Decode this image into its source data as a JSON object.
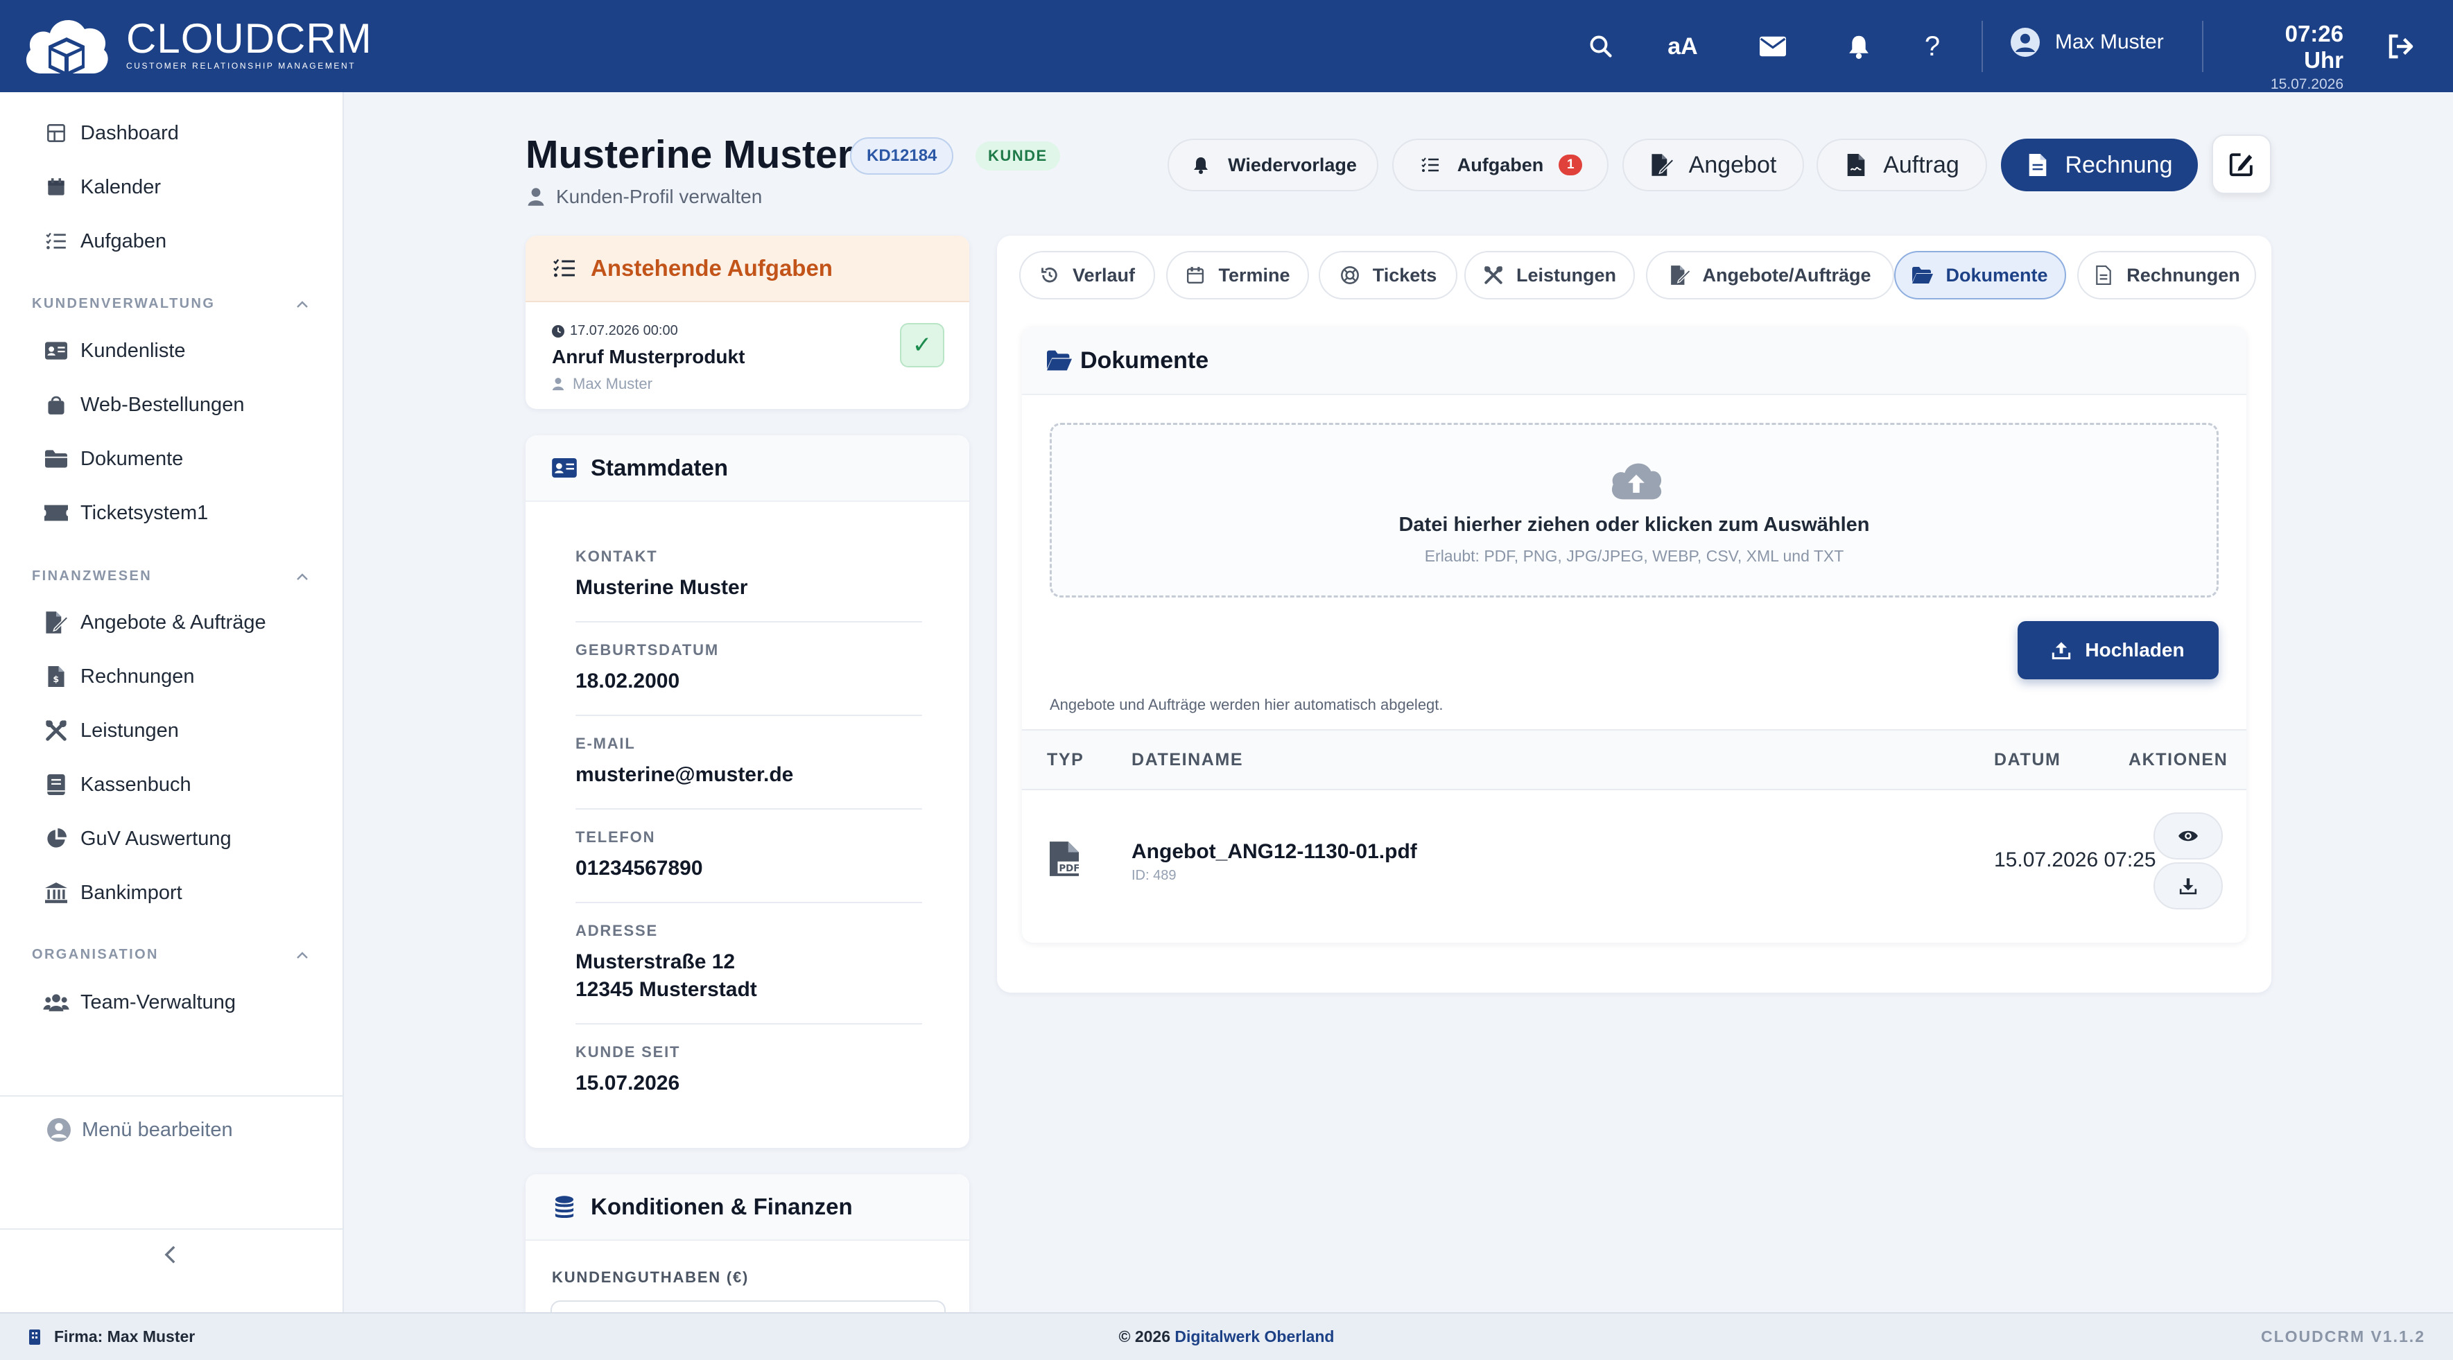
{
  "topbar": {
    "logo_name": "CLOUDCRM",
    "logo_sub": "CUSTOMER RELATIONSHIP MANAGEMENT",
    "font_size_label": "aA",
    "user_name": "Max Muster",
    "time": "07:26 Uhr",
    "date": "15.07.2026"
  },
  "sidebar": {
    "items_top": [
      {
        "label": "Dashboard",
        "icon": "dashboard-icon"
      },
      {
        "label": "Kalender",
        "icon": "calendar-icon"
      },
      {
        "label": "Aufgaben",
        "icon": "tasks-icon"
      }
    ],
    "sections": [
      {
        "title": "KUNDENVERWALTUNG",
        "items": [
          {
            "label": "Kundenliste",
            "icon": "id-card-icon"
          },
          {
            "label": "Web-Bestellungen",
            "icon": "shopping-bag-icon"
          },
          {
            "label": "Dokumente",
            "icon": "folder-icon"
          },
          {
            "label": "Ticketsystem1",
            "icon": "ticket-icon"
          }
        ]
      },
      {
        "title": "FINANZWESEN",
        "items": [
          {
            "label": "Angebote & Aufträge",
            "icon": "file-signature-icon"
          },
          {
            "label": "Rechnungen",
            "icon": "invoice-icon"
          },
          {
            "label": "Leistungen",
            "icon": "tools-icon"
          },
          {
            "label": "Kassenbuch",
            "icon": "book-icon"
          },
          {
            "label": "GuV Auswertung",
            "icon": "pie-chart-icon"
          },
          {
            "label": "Bankimport",
            "icon": "bank-icon"
          }
        ]
      },
      {
        "title": "ORGANISATION",
        "items": [
          {
            "label": "Team-Verwaltung",
            "icon": "users-icon"
          }
        ]
      }
    ],
    "menu_edit": "Menü bearbeiten"
  },
  "header": {
    "customer_name": "Musterine Muster",
    "customer_id": "KD12184",
    "customer_status": "KUNDE",
    "subtitle": "Kunden-Profil verwalten",
    "buttons": {
      "wiedervorlage": "Wiedervorlage",
      "aufgaben": "Aufgaben",
      "aufgaben_count": "1",
      "angebot": "Angebot",
      "auftrag": "Auftrag",
      "rechnung": "Rechnung"
    }
  },
  "tasks_card": {
    "title": "Anstehende Aufgaben",
    "task": {
      "date": "17.07.2026 00:00",
      "title": "Anruf Musterprodukt",
      "owner": "Max Muster",
      "done_symbol": "✓"
    }
  },
  "stammdaten": {
    "title": "Stammdaten",
    "fields": [
      {
        "label": "KONTAKT",
        "value": "Musterine Muster"
      },
      {
        "label": "GEBURTSDATUM",
        "value": "18.02.2000"
      },
      {
        "label": "E-MAIL",
        "value": "musterine@muster.de"
      },
      {
        "label": "TELEFON",
        "value": "01234567890"
      },
      {
        "label": "ADRESSE",
        "value": "Musterstraße 12",
        "value2": "12345 Musterstadt"
      },
      {
        "label": "KUNDE SEIT",
        "value": "15.07.2026"
      }
    ]
  },
  "konditionen": {
    "title": "Konditionen & Finanzen",
    "field_label": "KUNDENGUTHABEN (€)"
  },
  "tabs": [
    {
      "label": "Verlauf",
      "icon": "history-icon"
    },
    {
      "label": "Termine",
      "icon": "calendar-icon"
    },
    {
      "label": "Tickets",
      "icon": "support-icon"
    },
    {
      "label": "Leistungen",
      "icon": "tools-icon"
    },
    {
      "label": "Angebote/Aufträge",
      "icon": "file-signature-icon"
    },
    {
      "label": "Dokumente",
      "icon": "folder-open-icon",
      "active": true
    },
    {
      "label": "Rechnungen",
      "icon": "invoice-icon"
    }
  ],
  "documents": {
    "title": "Dokumente",
    "dropzone_title": "Datei hierher ziehen oder klicken zum Auswählen",
    "dropzone_sub": "Erlaubt: PDF, PNG, JPG/JPEG, WEBP, CSV, XML und TXT",
    "upload_label": "Hochladen",
    "auto_note": "Angebote und Aufträge werden hier automatisch abgelegt.",
    "columns": {
      "type": "TYP",
      "name": "DATEINAME",
      "date": "DATUM",
      "actions": "AKTIONEN"
    },
    "rows": [
      {
        "type_icon": "pdf-file-icon",
        "name": "Angebot_ANG12-1130-01.pdf",
        "id": "ID: 489",
        "date": "15.07.2026 07:25"
      }
    ]
  },
  "footer": {
    "firma": "Firma: Max Muster",
    "copyright": "© 2026",
    "company_link": "Digitalwerk Oberland",
    "version": "CLOUDCRM V1.1.2"
  },
  "colors": {
    "primary": "#1d4186",
    "accent_orange": "#c2541a",
    "badge_red": "#e0413b",
    "success": "#1c8b4e"
  }
}
